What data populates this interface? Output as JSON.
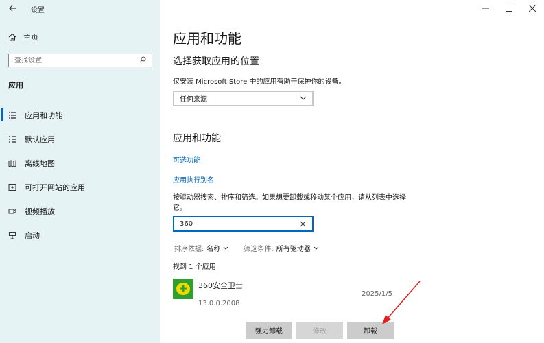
{
  "window": {
    "app_title": "设置",
    "back_icon": "back-arrow-icon",
    "controls": [
      "minimize-icon",
      "maximize-icon",
      "close-icon"
    ]
  },
  "sidebar": {
    "home_label": "主页",
    "search_placeholder": "查找设置",
    "section_label": "应用",
    "items": [
      {
        "label": "应用和功能",
        "icon": "apps-list-icon",
        "active": true
      },
      {
        "label": "默认应用",
        "icon": "default-apps-icon",
        "active": false
      },
      {
        "label": "离线地图",
        "icon": "offline-map-icon",
        "active": false
      },
      {
        "label": "可打开网站的应用",
        "icon": "website-apps-icon",
        "active": false
      },
      {
        "label": "视频播放",
        "icon": "video-playback-icon",
        "active": false
      },
      {
        "label": "启动",
        "icon": "startup-icon",
        "active": false
      }
    ]
  },
  "main": {
    "page_title": "应用和功能",
    "install_section": {
      "heading": "选择获取应用的位置",
      "description": "仅安装 Microsoft Store 中的应用有助于保护你的设备。",
      "dropdown_value": "任何来源"
    },
    "apps_section": {
      "heading": "应用和功能",
      "link_optional": "可选功能",
      "link_aliases": "应用执行别名",
      "description": "按驱动器搜索、排序和筛选。如果想要卸载或移动某个应用，请从列表中选择它。",
      "search_value": "360",
      "sort_label": "排序依据:",
      "sort_value": "名称",
      "filter_label": "筛选条件:",
      "filter_value": "所有驱动器",
      "found_text": "找到 1 个应用",
      "app": {
        "name": "360安全卫士",
        "date": "2025/1/5",
        "version": "13.0.0.2008"
      },
      "buttons": {
        "force_uninstall": "强力卸载",
        "modify": "修改",
        "uninstall": "卸载"
      }
    }
  },
  "colors": {
    "sidebar_bg": "#e6f3f5",
    "accent": "#0067c0",
    "annotation_arrow": "#e02020",
    "app_icon_bg": "#2f9f2f"
  }
}
